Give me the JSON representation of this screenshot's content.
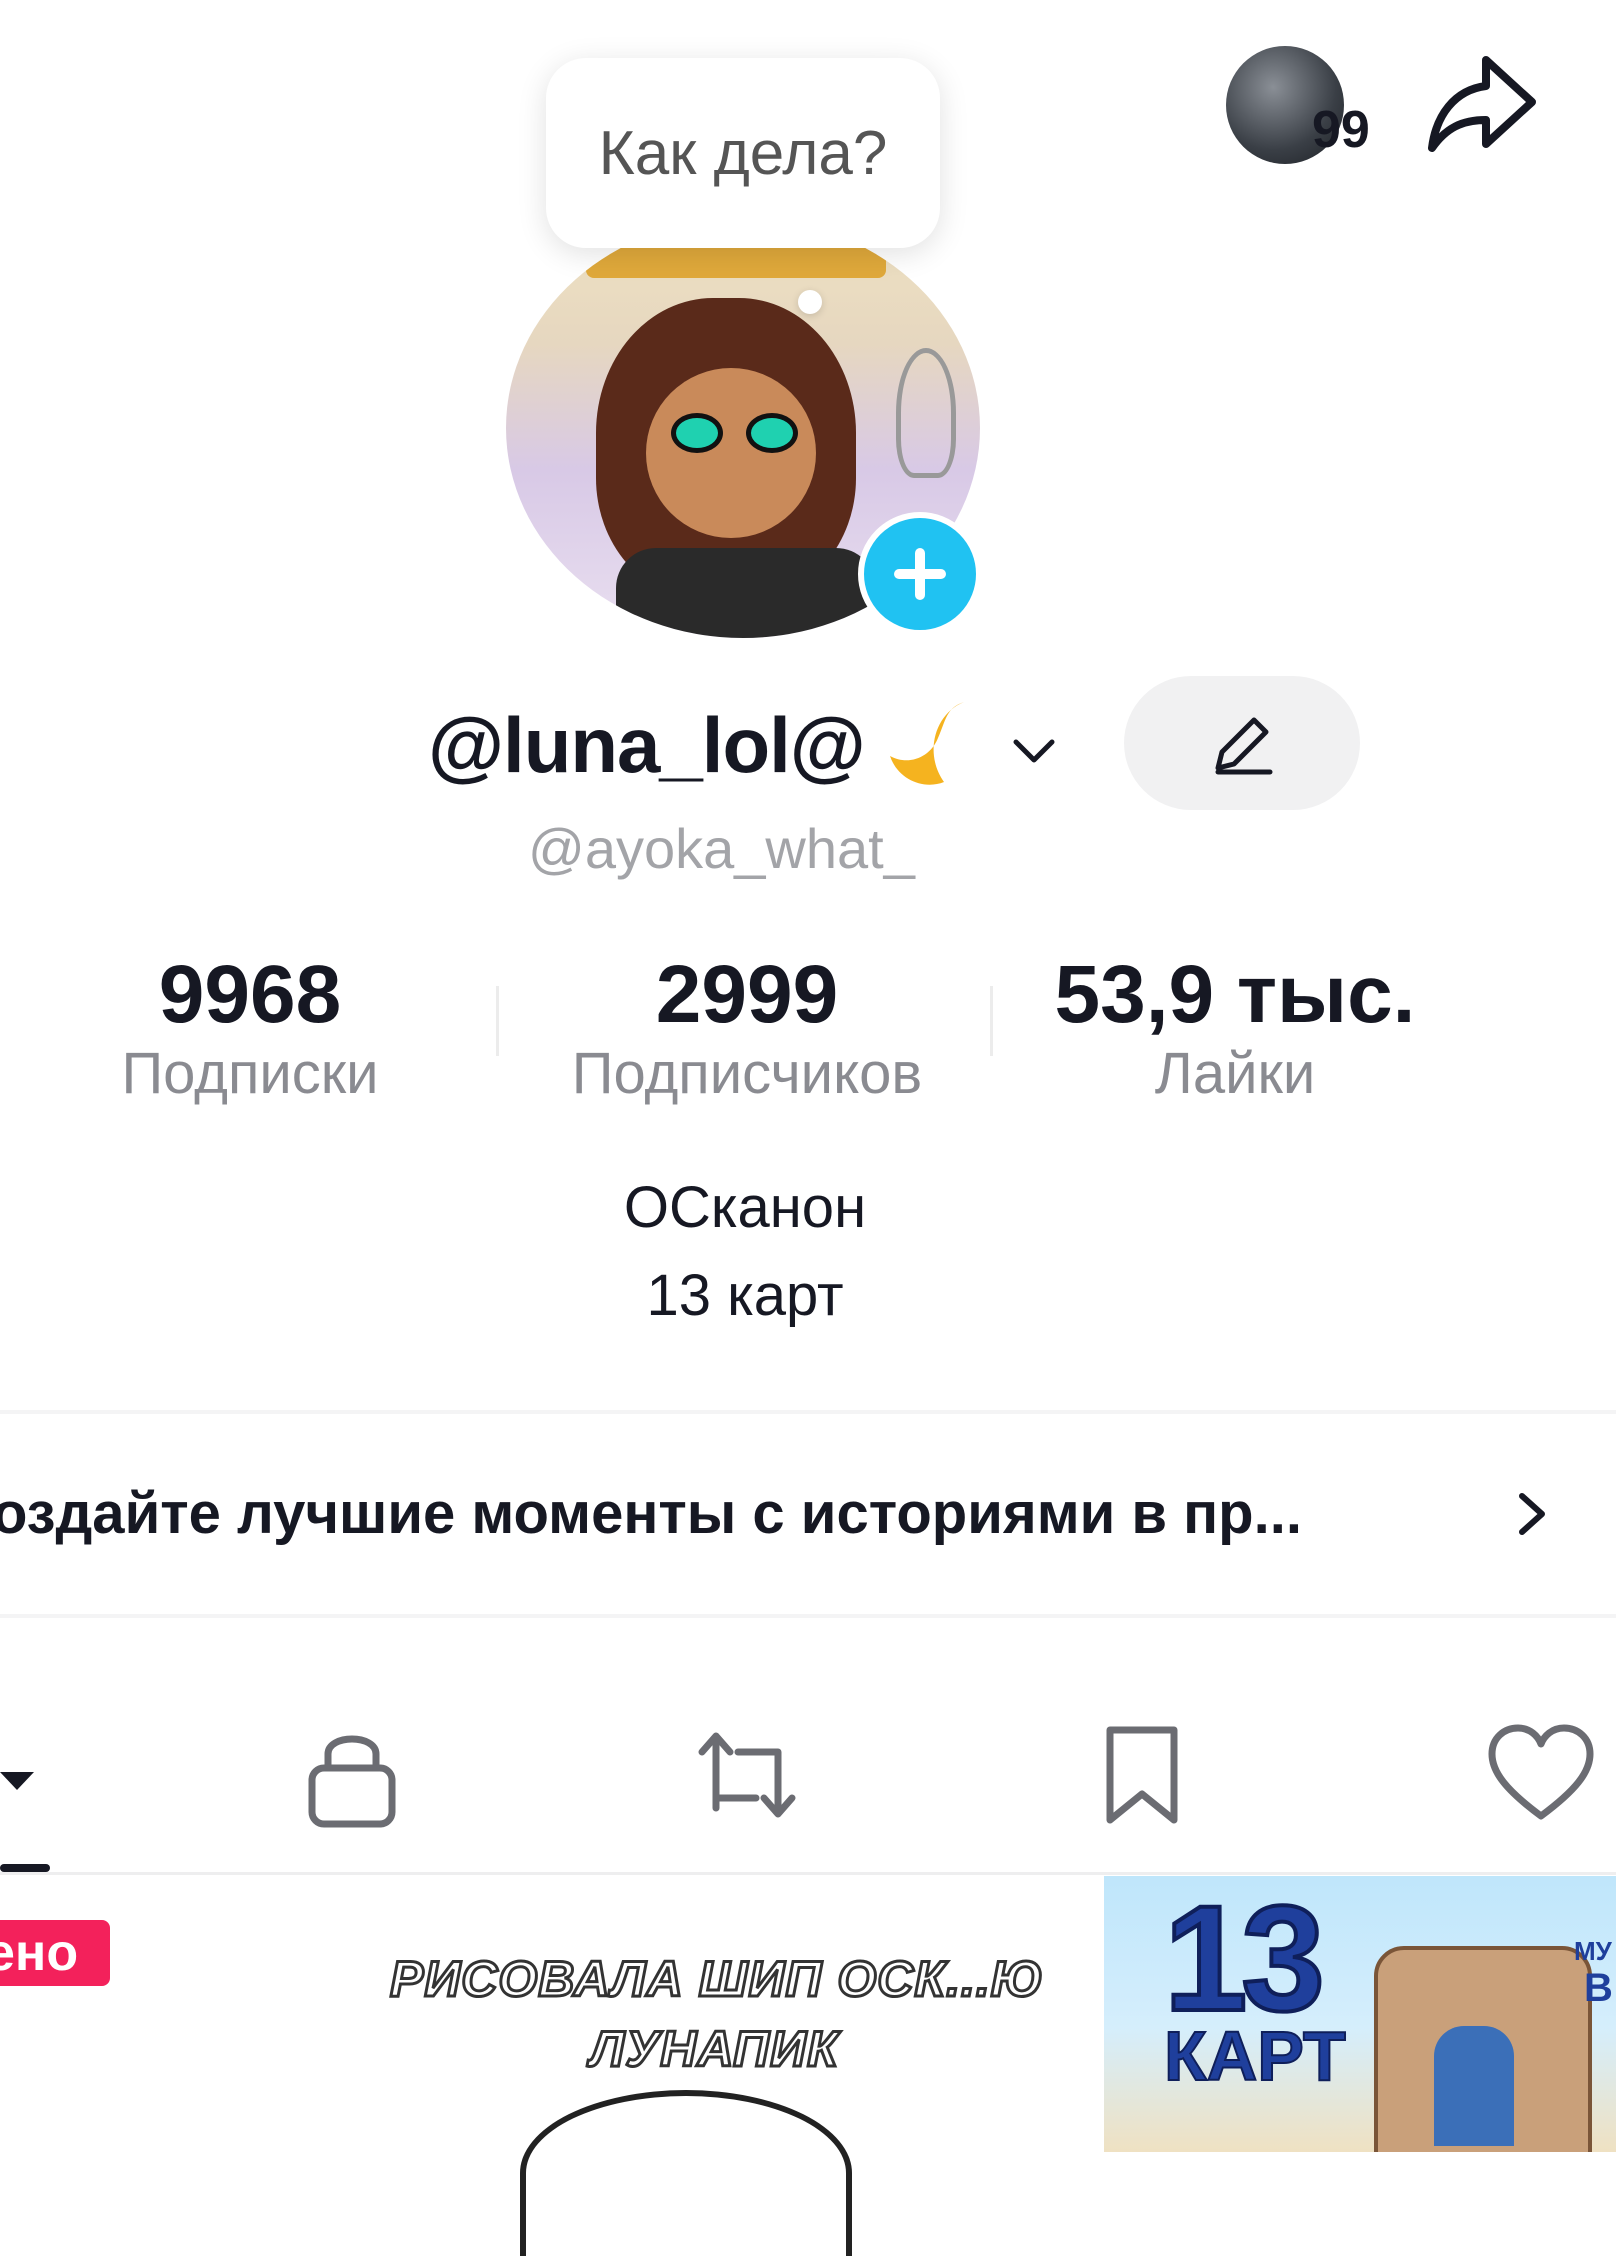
{
  "header": {
    "friends_count": "99"
  },
  "profile": {
    "status": "Как дела?",
    "display_name": "@luna_lol@",
    "username": "@ayoka_what_"
  },
  "stats": [
    {
      "value": "9968",
      "label": "Подписки"
    },
    {
      "value": "2999",
      "label": "Подписчиков"
    },
    {
      "value": "53,9 тыс.",
      "label": "Лайки"
    }
  ],
  "bio": {
    "line1": "ОСканон",
    "line2": "13 карт"
  },
  "stories_banner": {
    "text": "оздайте лучшие моменты с историями в пр..."
  },
  "tabs": {
    "icons": [
      "grid-icon",
      "lock-icon",
      "repost-icon",
      "bookmark-icon",
      "heart-icon"
    ]
  },
  "thumbnails": {
    "pinned_label": "ено",
    "video2_title_line1": "РИСОВАЛА ШИП ОСК...Ю",
    "video2_title_line2": "ЛУНАПИК",
    "video3_title_big": "13",
    "video3_title_small": "КАРТ",
    "video3_tag1": "МУ",
    "video3_tag2": "В"
  },
  "colors": {
    "accent_blue": "#20c2f2",
    "pinned_red": "#f3215b",
    "text_primary": "#161823",
    "text_secondary": "#8a8b91"
  }
}
